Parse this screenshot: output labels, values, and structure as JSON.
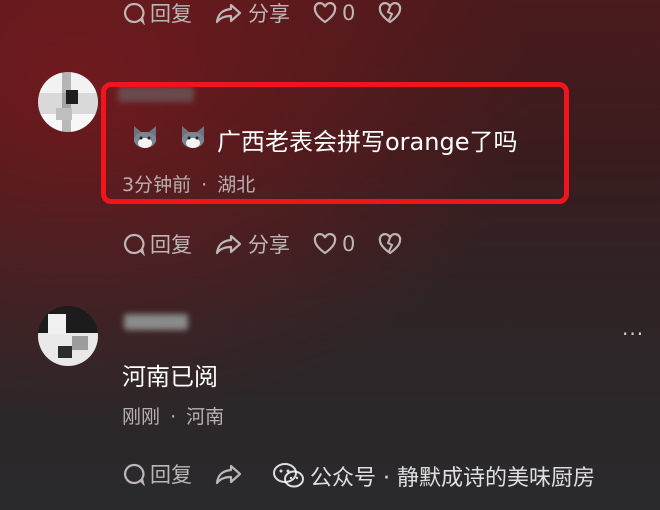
{
  "comments": [
    {
      "actions": {
        "reply": "回复",
        "share": "分享",
        "like_count": "0"
      }
    },
    {
      "text": "广西老表会拼写orange了吗",
      "emoji": [
        "cat-face-emoji",
        "cat-face-emoji"
      ],
      "time": "3分钟前",
      "separator": "·",
      "location": "湖北",
      "actions": {
        "reply": "回复",
        "share": "分享",
        "like_count": "0"
      }
    },
    {
      "text": "河南已阅",
      "time": "刚刚",
      "separator": "·",
      "location": "河南",
      "more": "···",
      "actions": {
        "reply": "回复"
      }
    }
  ],
  "watermark": {
    "text": "公众号 · 静默成诗的美味厨房"
  },
  "colors": {
    "highlight_border": "#f2141c",
    "meta_text": "#b9b0b0",
    "action_text": "#bdb6b6"
  }
}
